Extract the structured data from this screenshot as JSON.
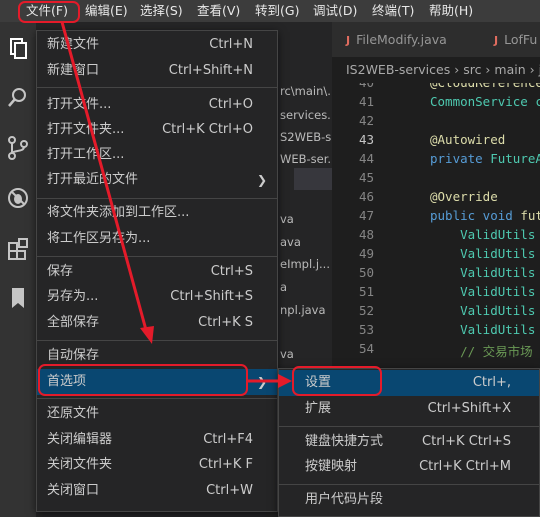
{
  "menubar": {
    "items": [
      "文件(F)",
      "编辑(E)",
      "选择(S)",
      "查看(V)",
      "转到(G)",
      "调试(D)",
      "终端(T)",
      "帮助(H)"
    ]
  },
  "tabs": [
    {
      "label": "FileModify.java"
    },
    {
      "label": "LofFu"
    }
  ],
  "breadcrumbs": [
    "IS2WEB-services",
    "src",
    "main",
    "ja"
  ],
  "explorer": {
    "paths": [
      "rc\\main\\...",
      "services...",
      "S2WEB-s...",
      "WEB-ser..."
    ],
    "files": [
      "va",
      "ava",
      "eImpl.j...",
      "a",
      "npl.java",
      "va"
    ]
  },
  "file_menu": {
    "items": [
      {
        "label": "新建文件",
        "key": "Ctrl+N"
      },
      {
        "label": "新建窗口",
        "key": "Ctrl+Shift+N"
      },
      {
        "label": "打开文件...",
        "key": "Ctrl+O"
      },
      {
        "label": "打开文件夹...",
        "key": "Ctrl+K Ctrl+O"
      },
      {
        "label": "打开工作区...",
        "key": ""
      },
      {
        "label": "打开最近的文件",
        "key": ""
      },
      {
        "label": "将文件夹添加到工作区...",
        "key": ""
      },
      {
        "label": "将工作区另存为...",
        "key": ""
      },
      {
        "label": "保存",
        "key": "Ctrl+S"
      },
      {
        "label": "另存为...",
        "key": "Ctrl+Shift+S"
      },
      {
        "label": "全部保存",
        "key": "Ctrl+K S"
      },
      {
        "label": "自动保存",
        "key": ""
      },
      {
        "label": "首选项",
        "key": ""
      },
      {
        "label": "还原文件",
        "key": ""
      },
      {
        "label": "关闭编辑器",
        "key": "Ctrl+F4"
      },
      {
        "label": "关闭文件夹",
        "key": "Ctrl+K F"
      },
      {
        "label": "关闭窗口",
        "key": "Ctrl+W"
      }
    ]
  },
  "prefs_submenu": {
    "items": [
      {
        "label": "设置",
        "key": "Ctrl+,"
      },
      {
        "label": "扩展",
        "key": "Ctrl+Shift+X"
      },
      {
        "label": "键盘快捷方式",
        "key": "Ctrl+K Ctrl+S"
      },
      {
        "label": "按键映射",
        "key": "Ctrl+K Ctrl+M"
      },
      {
        "label": "用户代码片段",
        "key": ""
      }
    ]
  },
  "editor": {
    "lines": [
      {
        "n": "40",
        "segs": [
          {
            "t": "@CloudReference",
            "c": "#dcdcaa"
          }
        ]
      },
      {
        "n": "41",
        "segs": [
          {
            "t": "CommonService c",
            "c": "#4ec9b0"
          }
        ]
      },
      {
        "n": "42",
        "segs": []
      },
      {
        "n": "43",
        "segs": [
          {
            "t": "@Autowired",
            "c": "#dcdcaa"
          }
        ]
      },
      {
        "n": "44",
        "segs": [
          {
            "t": "private ",
            "c": "#569cd6"
          },
          {
            "t": "FutureA",
            "c": "#4ec9b0"
          }
        ]
      },
      {
        "n": "45",
        "segs": []
      },
      {
        "n": "46",
        "segs": [
          {
            "t": "@Override",
            "c": "#dcdcaa"
          }
        ]
      },
      {
        "n": "47",
        "segs": [
          {
            "t": "public void ",
            "c": "#569cd6"
          },
          {
            "t": "fut",
            "c": "#dcdcaa"
          }
        ]
      },
      {
        "n": "48",
        "segs": [
          {
            "t": "    ValidUtils",
            "c": "#4ec9b0"
          }
        ]
      },
      {
        "n": "49",
        "segs": [
          {
            "t": "    ValidUtils",
            "c": "#4ec9b0"
          }
        ]
      },
      {
        "n": "50",
        "segs": [
          {
            "t": "    ValidUtils",
            "c": "#4ec9b0"
          }
        ]
      },
      {
        "n": "51",
        "segs": [
          {
            "t": "    ValidUtils",
            "c": "#4ec9b0"
          }
        ]
      },
      {
        "n": "52",
        "segs": [
          {
            "t": "    ValidUtils",
            "c": "#4ec9b0"
          }
        ]
      },
      {
        "n": "53",
        "segs": [
          {
            "t": "    ValidUtils",
            "c": "#4ec9b0"
          }
        ]
      },
      {
        "n": "54",
        "segs": [
          {
            "t": "    // 交易市场",
            "c": "#6a9955"
          }
        ]
      }
    ]
  },
  "colors": {
    "annotation": "#e41b2a",
    "menu_highlight": "#094771",
    "menu_bg": "#252526"
  }
}
